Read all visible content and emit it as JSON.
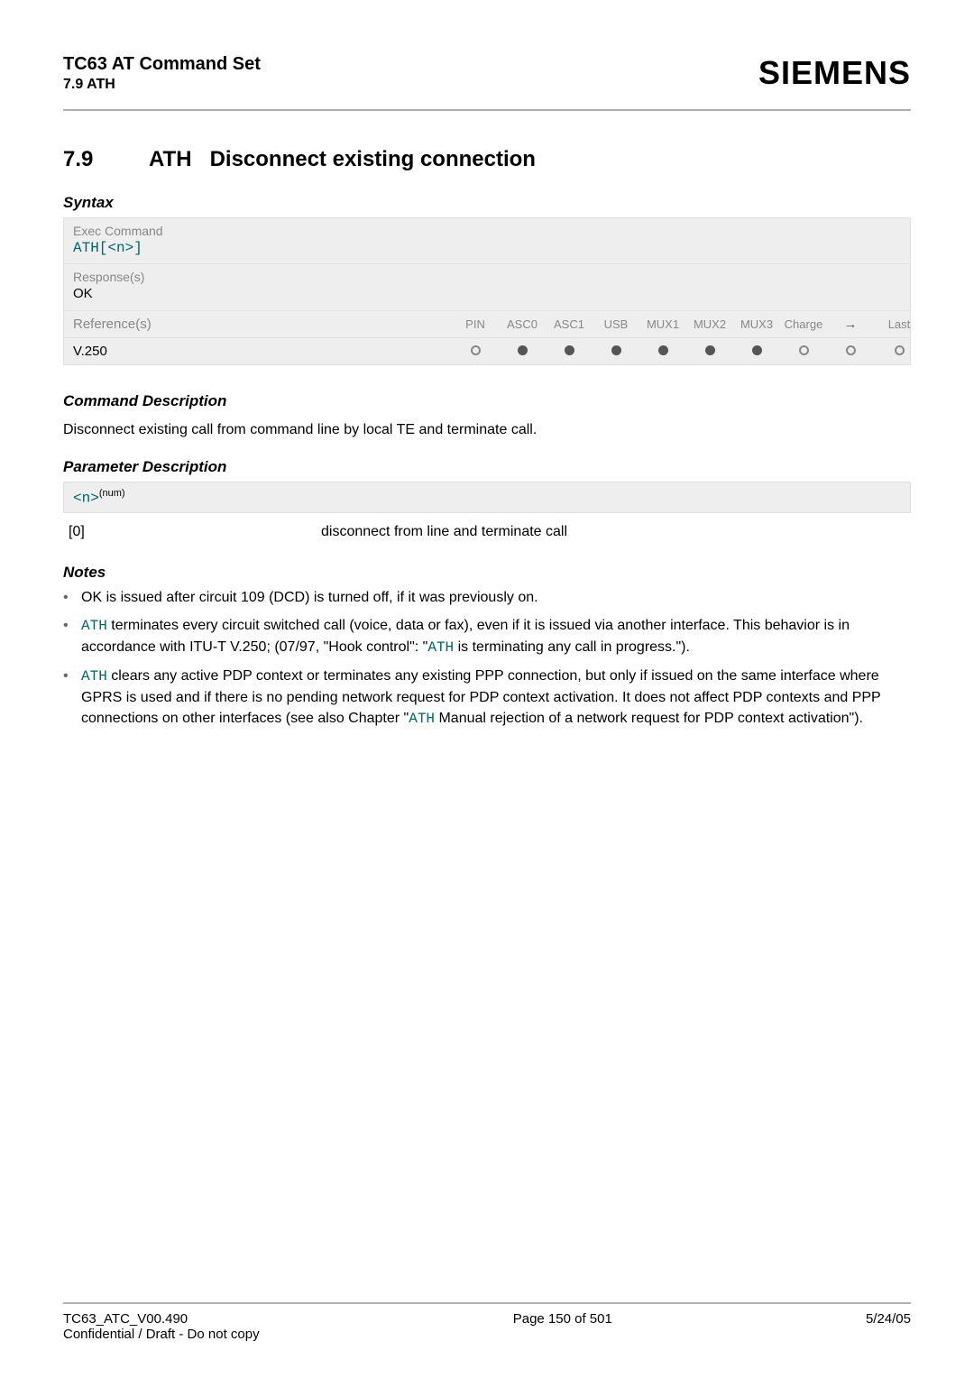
{
  "header": {
    "title": "TC63 AT Command Set",
    "subtitle": "7.9 ATH",
    "brand": "SIEMENS"
  },
  "section": {
    "number": "7.9",
    "cmd": "ATH",
    "title": "Disconnect existing connection"
  },
  "syntax": {
    "heading": "Syntax",
    "exec_label": "Exec Command",
    "exec_value_prefix": "ATH[",
    "exec_param": "<n>",
    "exec_value_suffix": "]",
    "response_label": "Response(s)",
    "response_value": "OK"
  },
  "ref": {
    "label": "Reference(s)",
    "value": "V.250",
    "cols": [
      "PIN",
      "ASC0",
      "ASC1",
      "USB",
      "MUX1",
      "MUX2",
      "MUX3",
      "Charge",
      "",
      "Last"
    ],
    "arrow": "✈",
    "dots": [
      "empty",
      "solid",
      "solid",
      "solid",
      "solid",
      "solid",
      "solid",
      "empty",
      "empty",
      "empty"
    ]
  },
  "cmd_desc": {
    "heading": "Command Description",
    "text": "Disconnect existing call from command line by local TE and terminate call."
  },
  "param_desc": {
    "heading": "Parameter Description",
    "param_name": "<n>",
    "param_type": "(num)",
    "row_key": "[0]",
    "row_val": "disconnect from line and terminate call"
  },
  "notes": {
    "heading": "Notes",
    "items": [
      {
        "pre": "OK is issued after circuit 109 (DCD) is turned off, if it was previously on."
      },
      {
        "mono1": "ATH",
        "mid1": " terminates every circuit switched call (voice, data or fax), even if it is issued via another interface. This behavior is in accordance with ITU-T V.250; (07/97, \"Hook control\": \"",
        "mono2": "ATH",
        "mid2": " is terminating any call in progress.\")."
      },
      {
        "mono1": "ATH",
        "mid1": " clears any active PDP context or terminates any existing PPP connection, but only if issued on the same interface where GPRS is used and if there is no pending network request for PDP context activation. It does not affect PDP contexts and PPP connections on other interfaces (see also Chapter \"",
        "mono2": "ATH",
        "mid2": " Manual rejection of a network request for PDP context activation\")."
      }
    ]
  },
  "footer": {
    "left1": "TC63_ATC_V00.490",
    "left2": "Confidential / Draft - Do not copy",
    "center": "Page 150 of 501",
    "right": "5/24/05"
  }
}
